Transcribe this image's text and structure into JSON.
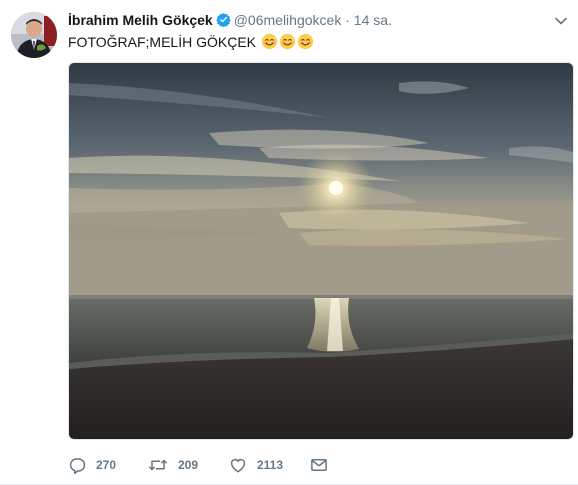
{
  "tweet": {
    "author_name": "İbrahim Melih Gökçek",
    "handle": "@06melihgokcek",
    "separator": "·",
    "time": "14 sa.",
    "text": "FOTOĞRAF;MELİH GÖKÇEK",
    "emoji": [
      "smiling-face-icon",
      "smiling-face-icon",
      "smiling-face-icon"
    ],
    "media_description_icon": "sunset-photo"
  },
  "actions": {
    "reply_count": "270",
    "retweet_count": "209",
    "like_count": "2113"
  },
  "colors": {
    "verified": "#1da1f2",
    "secondary_text": "#657786",
    "primary_text": "#14171a"
  }
}
